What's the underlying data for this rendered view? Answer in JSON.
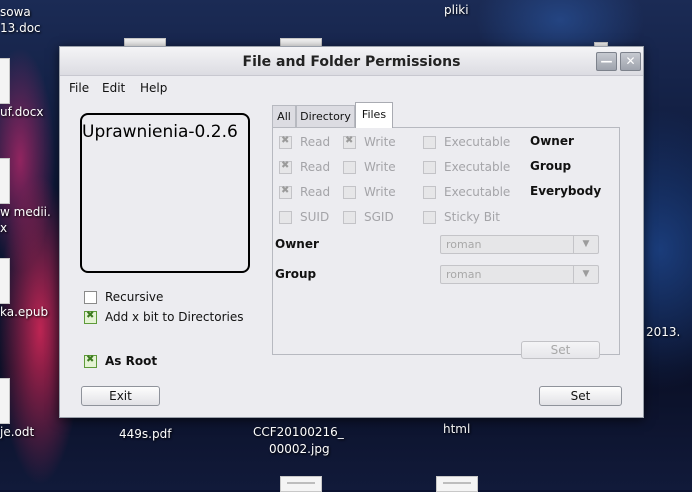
{
  "desktop": {
    "labels": [
      "sowa",
      "13.doc",
      "pliki",
      "uf.docx",
      "w medii.",
      "x",
      "ka.epub",
      "2013.",
      "je.odt",
      "449s.pdf",
      "CCF20100216_",
      "00002.jpg",
      "html"
    ]
  },
  "window": {
    "title": "File and Folder Permissions",
    "minimize_glyph": "—",
    "close_glyph": "✕"
  },
  "menu": {
    "file": "File",
    "edit": "Edit",
    "help": "Help"
  },
  "logo": {
    "text": "Uprawnienia-0.2.6"
  },
  "options": {
    "recursive": "Recursive",
    "add_x": "Add x bit to Directories",
    "as_root": "As Root"
  },
  "buttons": {
    "exit": "Exit",
    "set": "Set",
    "panel_set": "Set"
  },
  "tabs": {
    "all": "All",
    "directory": "Directory",
    "files": "Files"
  },
  "permissions": {
    "read": "Read",
    "write": "Write",
    "executable": "Executable",
    "suid": "SUID",
    "sgid": "SGID",
    "sticky": "Sticky Bit",
    "owner": "Owner",
    "group": "Group",
    "everybody": "Everybody"
  },
  "fields": {
    "owner_label": "Owner",
    "owner_value": "roman",
    "group_label": "Group",
    "group_value": "roman"
  },
  "icons": {
    "combo_arrow": "▼"
  }
}
